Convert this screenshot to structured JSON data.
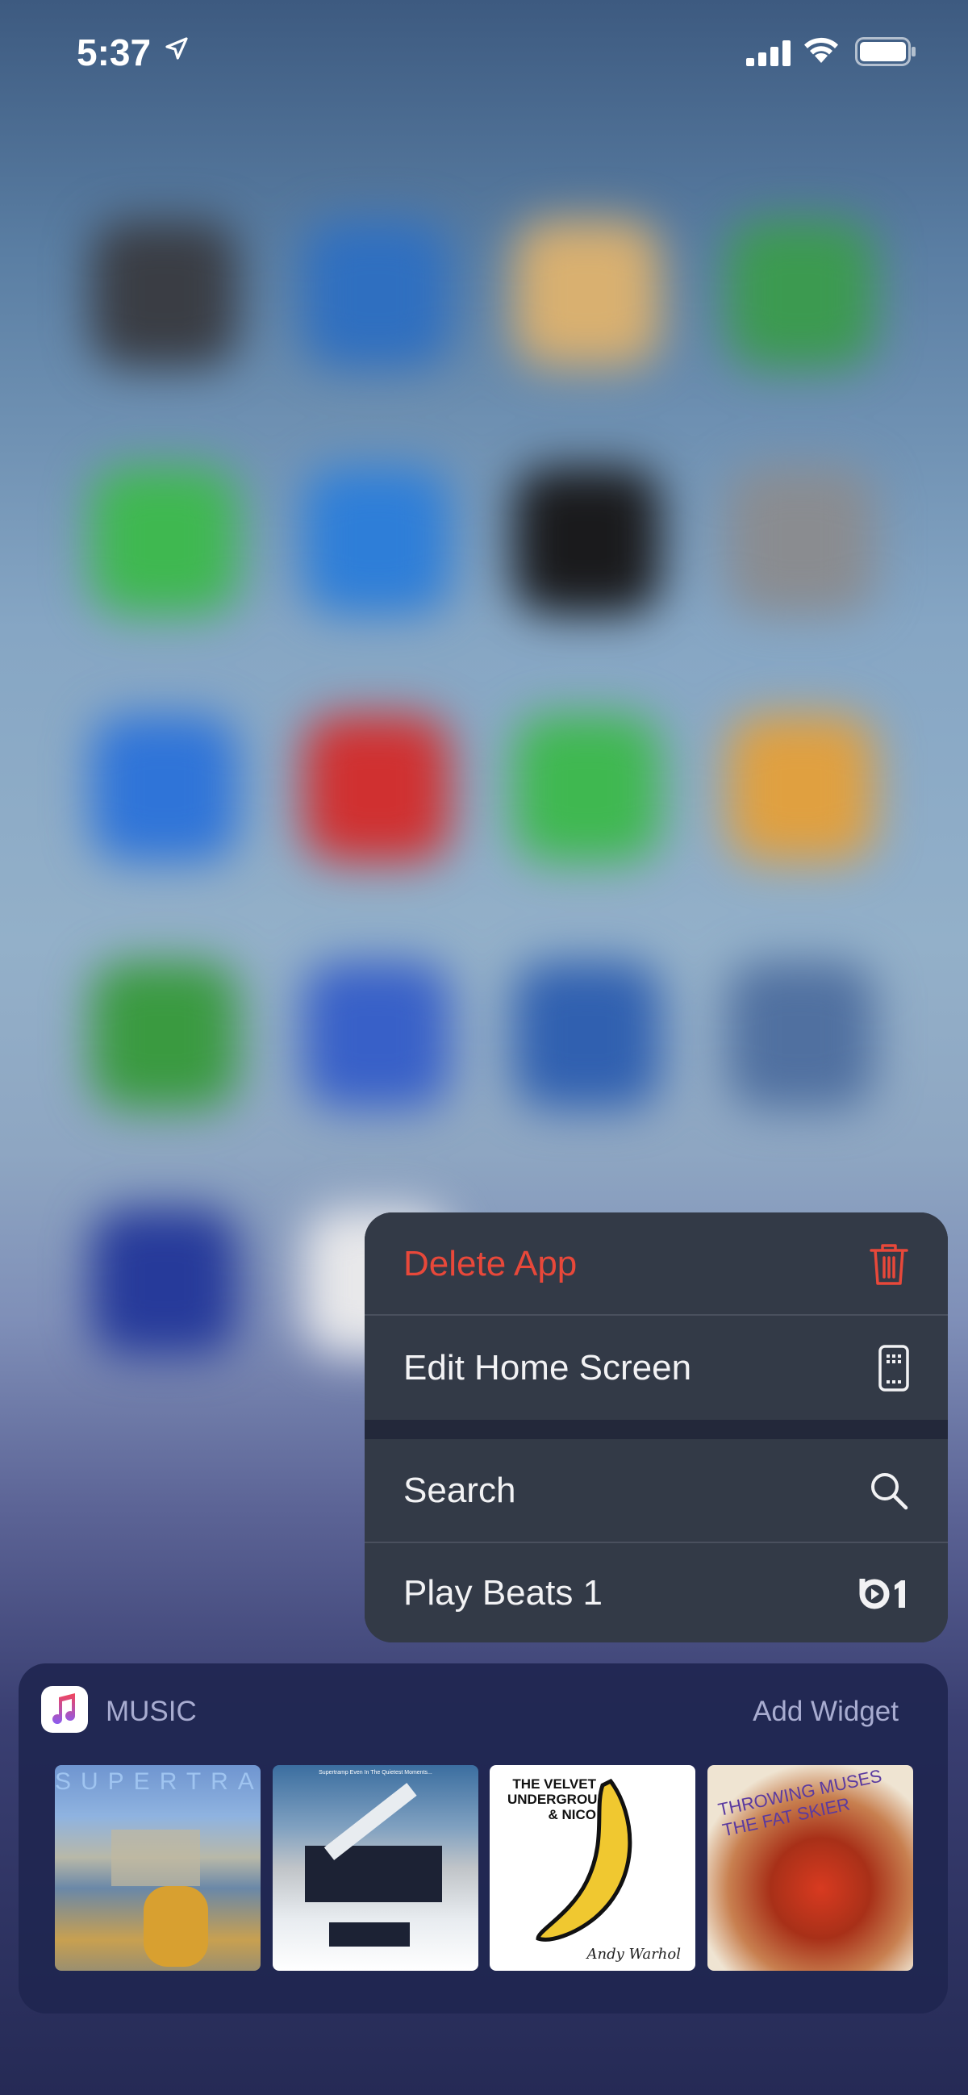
{
  "status_bar": {
    "time": "5:37",
    "location_icon": "location-arrow-icon",
    "signal_icon": "cellular-signal-icon",
    "wifi_icon": "wifi-icon",
    "battery_icon": "battery-icon"
  },
  "home_icons_blurred": [
    [
      "#3a3d44",
      "#2f6fc0",
      "#d9b070",
      "#3c9a50"
    ],
    [
      "#3fb850",
      "#2e7ed8",
      "#1a1a1c",
      "#8a8c90"
    ],
    [
      "#2f74d8",
      "#d03030",
      "#3fb850",
      "#e0a040"
    ],
    [
      "#3a9a40",
      "#3860c8",
      "#3060b0",
      "#5070a0"
    ],
    [
      "#263a9a",
      "#e8e8ea",
      "",
      ""
    ]
  ],
  "context_menu": {
    "items": [
      {
        "label": "Delete App",
        "icon": "trash-icon",
        "color": "#e8483a"
      },
      {
        "label": "Edit Home Screen",
        "icon": "phone-apps-icon"
      },
      {
        "label": "Search",
        "icon": "search-icon"
      },
      {
        "label": "Play Beats 1",
        "icon": "beats1-icon"
      }
    ]
  },
  "widget": {
    "app_icon": "music-app-icon",
    "title": "MUSIC",
    "add_label": "Add Widget",
    "albums": [
      {
        "name": "supertramp-album-cover",
        "logo_text": "SUPERTRAMP"
      },
      {
        "name": "supertramp-even-in-the-quietest-moments-cover",
        "logo_text": "Supertramp  Even In The Quietest Moments..."
      },
      {
        "name": "velvet-underground-nico-cover",
        "logo_text": "THE VELVET UNDERGROUND & NICO",
        "signature": "Andy Warhol"
      },
      {
        "name": "throwing-muses-fat-skier-cover",
        "logo_text": "THROWING MUSES THE FAT SKIER"
      }
    ]
  }
}
